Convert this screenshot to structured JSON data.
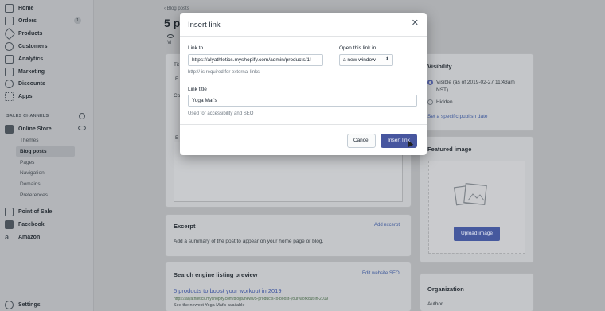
{
  "sidebar": {
    "items": [
      {
        "label": "Home",
        "icon": "home-icon"
      },
      {
        "label": "Orders",
        "icon": "orders-icon",
        "badge": "1"
      },
      {
        "label": "Products",
        "icon": "tag-icon"
      },
      {
        "label": "Customers",
        "icon": "person-icon"
      },
      {
        "label": "Analytics",
        "icon": "chart-icon"
      },
      {
        "label": "Marketing",
        "icon": "megaphone-icon"
      },
      {
        "label": "Discounts",
        "icon": "discount-icon"
      },
      {
        "label": "Apps",
        "icon": "apps-icon"
      }
    ],
    "sales_channels_header": "SALES CHANNELS",
    "online_store": "Online Store",
    "online_store_sub": [
      "Themes",
      "Blog posts",
      "Pages",
      "Navigation",
      "Domains",
      "Preferences"
    ],
    "other_channels": [
      {
        "label": "Point of Sale",
        "icon": "pos-icon"
      },
      {
        "label": "Facebook",
        "icon": "facebook-icon"
      },
      {
        "label": "Amazon",
        "icon": "amazon-icon"
      }
    ],
    "settings": "Settings"
  },
  "page": {
    "breadcrumb": "Blog posts",
    "title_fragment": "5 p",
    "view_fragment": "Vi",
    "left_fragments": [
      "Tit",
      "E",
      "Co",
      "E"
    ]
  },
  "excerpt": {
    "title": "Excerpt",
    "action": "Add excerpt",
    "text": "Add a summary of the post to appear on your home page or blog."
  },
  "seo": {
    "title": "Search engine listing preview",
    "action": "Edit website SEO",
    "preview_title": "5 products to boost your workout in 2019",
    "preview_url": "https://alyathletics.myshopify.com/blogs/news/5-products-to-boost-your-workout-in-2019",
    "preview_desc": "See the newest Yoga Mat's available"
  },
  "visibility": {
    "title": "Visibility",
    "visible_line1": "Visible (as of 2019-02-27 11:43am",
    "visible_line2": "NST)",
    "hidden": "Hidden",
    "publish_link": "Set a specific publish date"
  },
  "featured": {
    "title": "Featured image",
    "upload": "Upload image"
  },
  "organization": {
    "title": "Organization",
    "author": "Author"
  },
  "modal": {
    "title": "Insert link",
    "link_to_label": "Link to",
    "link_to_value": "https://alyathletics.myshopify.com/admin/products/1!",
    "link_help": "http:// is required for external links",
    "open_label": "Open this link in",
    "open_value": "a new window",
    "link_title_label": "Link title",
    "link_title_value": "Yoga Mat's",
    "title_help": "Used for accessibility and SEO",
    "cancel": "Cancel",
    "insert": "Insert link"
  },
  "colors": {
    "primary": "#47569f",
    "link": "#3f5a9c"
  }
}
